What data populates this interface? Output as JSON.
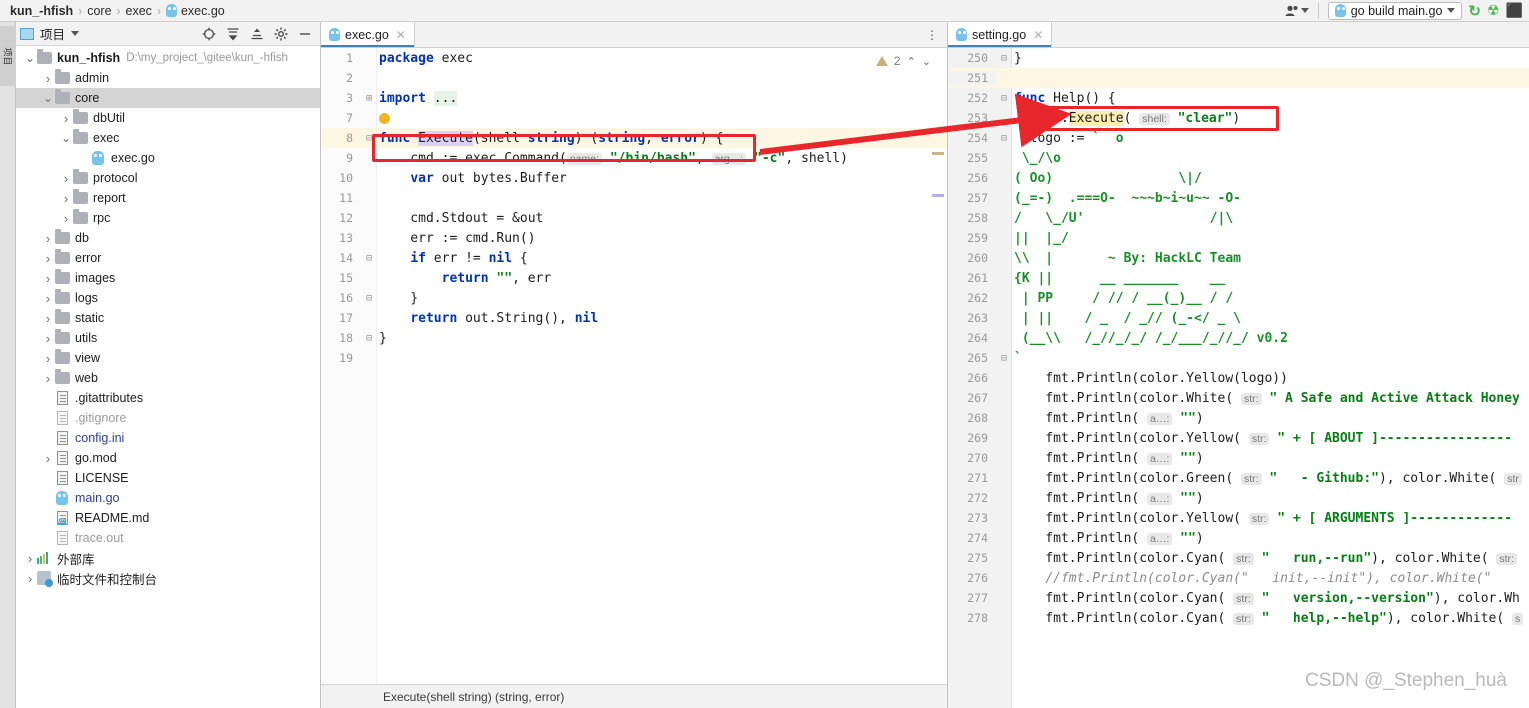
{
  "navbar": {
    "breadcrumbs": [
      {
        "label": "kun_-hfish",
        "bold": true
      },
      {
        "label": "core",
        "bold": false
      },
      {
        "label": "exec",
        "bold": false
      },
      {
        "label": "exec.go",
        "bold": false,
        "icon": "go-file-icon"
      }
    ],
    "separator": "›",
    "profile_icon": "user-profile-icon",
    "run_config": {
      "label": "go build main.go",
      "icon": "go-run-config-icon",
      "dropdown_icon": "chevron-down-icon"
    },
    "actions": [
      {
        "name": "rerun-icon",
        "glyph": "↻",
        "color": "#4caf50"
      },
      {
        "name": "debug-icon",
        "glyph": "☢",
        "color": "#4caf50"
      },
      {
        "name": "stop-icon",
        "glyph": "■",
        "color": "#9aa0a6"
      }
    ]
  },
  "toolstrip": {
    "project_tab": "项目"
  },
  "project": {
    "title": "项目",
    "dropdown_icon": "chevron-down-icon",
    "header_icons": [
      {
        "name": "locate-file-icon",
        "glyph": "⊕"
      },
      {
        "name": "expand-all-icon",
        "glyph": "≣"
      },
      {
        "name": "collapse-all-icon",
        "glyph": "≡"
      },
      {
        "name": "settings-gear-icon",
        "glyph": "⚙"
      },
      {
        "name": "hide-panel-icon",
        "glyph": "—"
      }
    ],
    "tree": [
      {
        "indent": 0,
        "twist": "v",
        "icon": "folder-icon",
        "label": "kun_-hfish",
        "bold": true,
        "path": "D:\\my_project_\\gitee\\kun_-hfish",
        "selected": false
      },
      {
        "indent": 1,
        "twist": ">",
        "icon": "folder-icon",
        "label": "admin",
        "selected": false
      },
      {
        "indent": 1,
        "twist": "v",
        "icon": "folder-icon",
        "label": "core",
        "selected": true
      },
      {
        "indent": 2,
        "twist": ">",
        "icon": "folder-icon",
        "label": "dbUtil",
        "selected": false
      },
      {
        "indent": 2,
        "twist": "v",
        "icon": "folder-icon",
        "label": "exec",
        "selected": false
      },
      {
        "indent": 3,
        "twist": "",
        "icon": "go-file-icon",
        "label": "exec.go",
        "selected": false
      },
      {
        "indent": 2,
        "twist": ">",
        "icon": "folder-icon",
        "label": "protocol",
        "selected": false
      },
      {
        "indent": 2,
        "twist": ">",
        "icon": "folder-icon",
        "label": "report",
        "selected": false
      },
      {
        "indent": 2,
        "twist": ">",
        "icon": "folder-icon",
        "label": "rpc",
        "selected": false
      },
      {
        "indent": 1,
        "twist": ">",
        "icon": "folder-icon",
        "label": "db",
        "selected": false
      },
      {
        "indent": 1,
        "twist": ">",
        "icon": "folder-icon",
        "label": "error",
        "selected": false
      },
      {
        "indent": 1,
        "twist": ">",
        "icon": "folder-icon",
        "label": "images",
        "selected": false
      },
      {
        "indent": 1,
        "twist": ">",
        "icon": "folder-icon",
        "label": "logs",
        "selected": false
      },
      {
        "indent": 1,
        "twist": ">",
        "icon": "folder-icon",
        "label": "static",
        "selected": false
      },
      {
        "indent": 1,
        "twist": ">",
        "icon": "folder-icon",
        "label": "utils",
        "selected": false
      },
      {
        "indent": 1,
        "twist": ">",
        "icon": "folder-icon",
        "label": "view",
        "selected": false
      },
      {
        "indent": 1,
        "twist": ">",
        "icon": "folder-icon",
        "label": "web",
        "selected": false
      },
      {
        "indent": 1,
        "twist": "",
        "icon": "file-icon",
        "label": ".gitattributes",
        "selected": false
      },
      {
        "indent": 1,
        "twist": "",
        "icon": "file-ignored-icon",
        "label": ".gitignore",
        "color": "grey",
        "selected": false
      },
      {
        "indent": 1,
        "twist": "",
        "icon": "file-icon",
        "label": "config.ini",
        "color": "blue",
        "selected": false
      },
      {
        "indent": 1,
        "twist": ">",
        "icon": "file-icon",
        "label": "go.mod",
        "selected": false
      },
      {
        "indent": 1,
        "twist": "",
        "icon": "file-icon",
        "label": "LICENSE",
        "selected": false
      },
      {
        "indent": 1,
        "twist": "",
        "icon": "go-file-icon",
        "label": "main.go",
        "color": "blue",
        "selected": false
      },
      {
        "indent": 1,
        "twist": "",
        "icon": "markdown-file-icon",
        "label": "README.md",
        "selected": false
      },
      {
        "indent": 1,
        "twist": "",
        "icon": "file-unknown-icon",
        "label": "trace.out",
        "color": "grey",
        "selected": false
      },
      {
        "indent": 0,
        "twist": ">",
        "icon": "external-libraries-icon",
        "label": "外部库",
        "selected": false
      },
      {
        "indent": 0,
        "twist": ">",
        "icon": "scratches-console-icon",
        "label": "临时文件和控制台",
        "selected": false
      }
    ]
  },
  "editor_left": {
    "tab": {
      "label": "exec.go",
      "icon": "go-file-icon",
      "close_icon": "close-icon",
      "active": true
    },
    "more_icon": "more-options-icon",
    "inspections": {
      "count": "2",
      "icon": "warning-triangle-icon",
      "up_icon": "chevron-up-icon",
      "down_icon": "chevron-down-icon"
    },
    "status_text": "Execute(shell string) (string, error)",
    "lines": [
      {
        "num": "1",
        "fold": "",
        "highlight": false,
        "html": "<span class='kw'>package</span> exec"
      },
      {
        "num": "2",
        "fold": "",
        "highlight": false,
        "html": ""
      },
      {
        "num": "3",
        "fold": "⊞",
        "highlight": false,
        "html": "<span class='kw'>import</span> <span class='impfold'>...</span>"
      },
      {
        "num": "7",
        "fold": "",
        "highlight": false,
        "html": "",
        "bulb": true
      },
      {
        "num": "8",
        "fold": "⊟",
        "highlight": true,
        "html": "<span class='kw'>func</span> <span class='sel-ident'>Execute</span>(shell <span class='kw'>string</span>) (<span class='kw'>string</span>, <span class='kw'>error</span>) {"
      },
      {
        "num": "9",
        "fold": "",
        "highlight": false,
        "html": "    cmd := exec.Command(<span class='hint'>name:</span> <span class='str'>\"/bin/bash\"</span>, <span class='hint'>arg…:</span> <span class='str'>\"-c\"</span>, shell)"
      },
      {
        "num": "10",
        "fold": "",
        "highlight": false,
        "html": "    <span class='kw'>var</span> out bytes.Buffer"
      },
      {
        "num": "11",
        "fold": "",
        "highlight": false,
        "html": ""
      },
      {
        "num": "12",
        "fold": "",
        "highlight": false,
        "html": "    cmd.Stdout = &amp;out"
      },
      {
        "num": "13",
        "fold": "",
        "highlight": false,
        "html": "    err := cmd.Run()"
      },
      {
        "num": "14",
        "fold": "⊟",
        "highlight": false,
        "html": "    <span class='kw'>if</span> err != <span class='kw'>nil</span> {"
      },
      {
        "num": "15",
        "fold": "",
        "highlight": false,
        "html": "        <span class='kw'>return</span> <span class='str'>\"\"</span>, err"
      },
      {
        "num": "16",
        "fold": "⊟",
        "highlight": false,
        "html": "    }"
      },
      {
        "num": "17",
        "fold": "",
        "highlight": false,
        "html": "    <span class='kw'>return</span> out.String(), <span class='kw'>nil</span>"
      },
      {
        "num": "18",
        "fold": "⊟",
        "highlight": false,
        "html": "}"
      },
      {
        "num": "19",
        "fold": "",
        "highlight": false,
        "html": ""
      }
    ]
  },
  "editor_right": {
    "tab": {
      "label": "setting.go",
      "icon": "go-file-icon",
      "close_icon": "close-icon",
      "active": true
    },
    "lines": [
      {
        "num": "250",
        "fold": "⊟",
        "highlight": false,
        "html": "}"
      },
      {
        "num": "251",
        "fold": "",
        "highlight": true,
        "html": ""
      },
      {
        "num": "252",
        "fold": "⊟",
        "highlight": false,
        "html": "<span class='kw'>func</span> Help() {"
      },
      {
        "num": "253",
        "fold": "",
        "highlight": false,
        "html": "  exec.<span class='sel-ident2'>Execute</span>( <span class='hint'>shell:</span> <span class='str'>\"clear\"</span>)"
      },
      {
        "num": "254",
        "fold": "⊟",
        "highlight": false,
        "html": "  logo := <span class='grn'>`  o</span>"
      },
      {
        "num": "255",
        "fold": "",
        "highlight": false,
        "html": "<span class='grn'> \\_/\\o</span>"
      },
      {
        "num": "256",
        "fold": "",
        "highlight": false,
        "html": "<span class='grn'>( Oo)                \\|/</span>"
      },
      {
        "num": "257",
        "fold": "",
        "highlight": false,
        "html": "<span class='grn'>(_=-)  .===O-  ~~~b~i~u~~ -O-</span>"
      },
      {
        "num": "258",
        "fold": "",
        "highlight": false,
        "html": "<span class='grn'>/   \\_/U'                /|\\</span>"
      },
      {
        "num": "259",
        "fold": "",
        "highlight": false,
        "html": "<span class='grn'>||  |_/</span>"
      },
      {
        "num": "260",
        "fold": "",
        "highlight": false,
        "html": "<span class='grn'>\\\\  |       ~ By: HackLC Team</span>"
      },
      {
        "num": "261",
        "fold": "",
        "highlight": false,
        "html": "<span class='grn'>{K ||      __ _______    __</span>"
      },
      {
        "num": "262",
        "fold": "",
        "highlight": false,
        "html": "<span class='grn'> | PP     / // / __(_)__ / /</span>"
      },
      {
        "num": "263",
        "fold": "",
        "highlight": false,
        "html": "<span class='grn'> | ||    / _  / _// (_-&lt;/ _ \\</span>"
      },
      {
        "num": "264",
        "fold": "",
        "highlight": false,
        "html": "<span class='grn'> (__\\\\   /_//_/_/ /_/___/_//_/ v0.2</span>"
      },
      {
        "num": "265",
        "fold": "⊟",
        "highlight": false,
        "html": "<span class='grn'>`</span>"
      },
      {
        "num": "266",
        "fold": "",
        "highlight": false,
        "html": "    fmt.Println(color.Yellow(logo))"
      },
      {
        "num": "267",
        "fold": "",
        "highlight": false,
        "html": "    fmt.Println(color.White( <span class='hint'>str:</span> <span class='str'>\" A Safe and Active Attack Honey</span>"
      },
      {
        "num": "268",
        "fold": "",
        "highlight": false,
        "html": "    fmt.Println( <span class='hint'>a…:</span> <span class='str'>\"\"</span>)"
      },
      {
        "num": "269",
        "fold": "",
        "highlight": false,
        "html": "    fmt.Println(color.Yellow( <span class='hint'>str:</span> <span class='str'>\" + [ ABOUT ]-----------------</span>"
      },
      {
        "num": "270",
        "fold": "",
        "highlight": false,
        "html": "    fmt.Println( <span class='hint'>a…:</span> <span class='str'>\"\"</span>)"
      },
      {
        "num": "271",
        "fold": "",
        "highlight": false,
        "html": "    fmt.Println(color.Green( <span class='hint'>str:</span> <span class='str'>\"   - Github:\"</span>), color.White( <span class='hint'>str</span>"
      },
      {
        "num": "272",
        "fold": "",
        "highlight": false,
        "html": "    fmt.Println( <span class='hint'>a…:</span> <span class='str'>\"\"</span>)"
      },
      {
        "num": "273",
        "fold": "",
        "highlight": false,
        "html": "    fmt.Println(color.Yellow( <span class='hint'>str:</span> <span class='str'>\" + [ ARGUMENTS ]-------------</span>"
      },
      {
        "num": "274",
        "fold": "",
        "highlight": false,
        "html": "    fmt.Println( <span class='hint'>a…:</span> <span class='str'>\"\"</span>)"
      },
      {
        "num": "275",
        "fold": "",
        "highlight": false,
        "html": "    fmt.Println(color.Cyan( <span class='hint'>str:</span> <span class='str'>\"   run,--run\"</span>), color.White( <span class='hint'>str:</span>"
      },
      {
        "num": "276",
        "fold": "",
        "highlight": false,
        "html": "    <span class='cmt'>//fmt.Println(color.Cyan(\"   init,--init\"), color.White(\"</span>"
      },
      {
        "num": "277",
        "fold": "",
        "highlight": false,
        "html": "    fmt.Println(color.Cyan( <span class='hint'>str:</span> <span class='str'>\"   version,--version\"</span>), color.Wh"
      },
      {
        "num": "278",
        "fold": "",
        "highlight": false,
        "html": "    fmt.Println(color.Cyan( <span class='hint'>str:</span> <span class='str'>\"   help,--help\"</span>), color.White( <span class='hint'>s</span>"
      }
    ]
  },
  "annotations": {
    "color": "#e8272c",
    "box_left": {
      "label": "func Execute(shell string) (string, error) {"
    },
    "box_right": {
      "label": "exec.Execute( shell: \"clear\")"
    },
    "arrow": "arrow-pointing-right"
  },
  "watermark": "CSDN @_Stephen_huà"
}
